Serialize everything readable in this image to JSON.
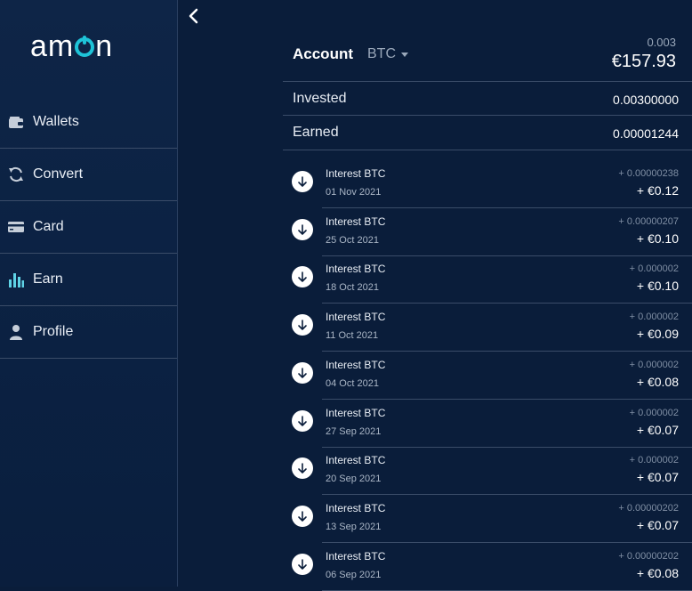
{
  "brand": {
    "logo_text": "amon"
  },
  "sidebar": {
    "items": [
      {
        "label": "Wallets",
        "icon": "wallet-icon",
        "active": false
      },
      {
        "label": "Convert",
        "icon": "convert-icon",
        "active": false
      },
      {
        "label": "Card",
        "icon": "card-icon",
        "active": false
      },
      {
        "label": "Earn",
        "icon": "bar-chart-icon",
        "active": true
      },
      {
        "label": "Profile",
        "icon": "profile-icon",
        "active": false
      }
    ]
  },
  "header": {
    "back_icon": "chevron-left-icon",
    "account_label": "Account",
    "currency": "BTC",
    "balance_btc": "0.003",
    "balance_eur": "€157.93"
  },
  "summary": {
    "invested_label": "Invested",
    "invested_value": "0.00300000",
    "earned_label": "Earned",
    "earned_value": "0.00001244"
  },
  "transactions": [
    {
      "title": "Interest BTC",
      "date": "01 Nov 2021",
      "btc": "+ 0.00000238",
      "eur": "+ €0.12"
    },
    {
      "title": "Interest BTC",
      "date": "25 Oct 2021",
      "btc": "+ 0.00000207",
      "eur": "+ €0.10"
    },
    {
      "title": "Interest BTC",
      "date": "18 Oct 2021",
      "btc": "+ 0.000002",
      "eur": "+ €0.10"
    },
    {
      "title": "Interest BTC",
      "date": "11 Oct 2021",
      "btc": "+ 0.000002",
      "eur": "+ €0.09"
    },
    {
      "title": "Interest BTC",
      "date": "04 Oct 2021",
      "btc": "+ 0.000002",
      "eur": "+ €0.08"
    },
    {
      "title": "Interest BTC",
      "date": "27 Sep 2021",
      "btc": "+ 0.000002",
      "eur": "+ €0.07"
    },
    {
      "title": "Interest BTC",
      "date": "20 Sep 2021",
      "btc": "+ 0.000002",
      "eur": "+ €0.07"
    },
    {
      "title": "Interest BTC",
      "date": "13 Sep 2021",
      "btc": "+ 0.00000202",
      "eur": "+ €0.07"
    },
    {
      "title": "Interest BTC",
      "date": "06 Sep 2021",
      "btc": "+ 0.00000202",
      "eur": "+ €0.08"
    }
  ],
  "colors": {
    "background": "#0a1d3a",
    "accent": "#1ec3d8",
    "text_muted": "#9aa8ba"
  }
}
